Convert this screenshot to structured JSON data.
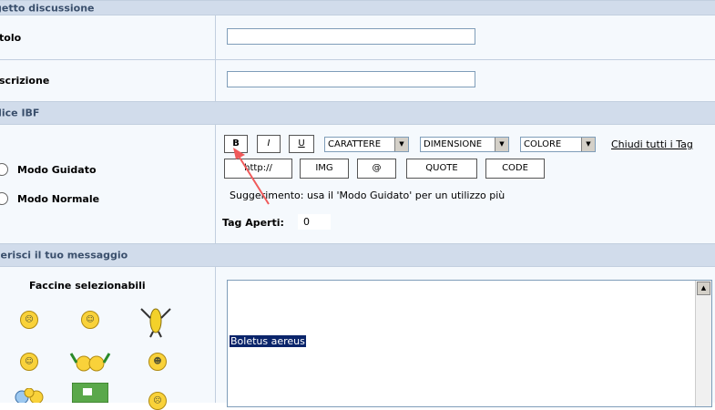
{
  "sections": {
    "topic": "getto discussione",
    "ibf": "dice IBF",
    "message": "serisci il tuo messaggio"
  },
  "fields": {
    "title_label": "tolo",
    "description_label": "scrizione",
    "title_value": "",
    "description_value": ""
  },
  "mode": {
    "guided": "Modo Guidato",
    "normal": "Modo Normale"
  },
  "toolbar": {
    "bold": "B",
    "italic": "I",
    "underline": "U",
    "font": "CARATTERE",
    "size": "DIMENSIONE",
    "color": "COLORE",
    "close_tags": "Chiudi tutti i Tag",
    "http": "http://",
    "img": "IMG",
    "email": "@",
    "quote": "QUOTE",
    "code": "CODE"
  },
  "hint": "Suggerimento: usa il 'Modo Guidato' per un utilizzo più",
  "open_tags_label": "Tag Aperti:",
  "open_tags_value": "0",
  "emoticons_title": "Faccine selezionabili",
  "message_text": "Boletus aereus",
  "colors": {
    "band": "#d1dceb",
    "row": "#f5f9fd",
    "border": "#c2cfdf",
    "arrow": "#f05a5a"
  }
}
